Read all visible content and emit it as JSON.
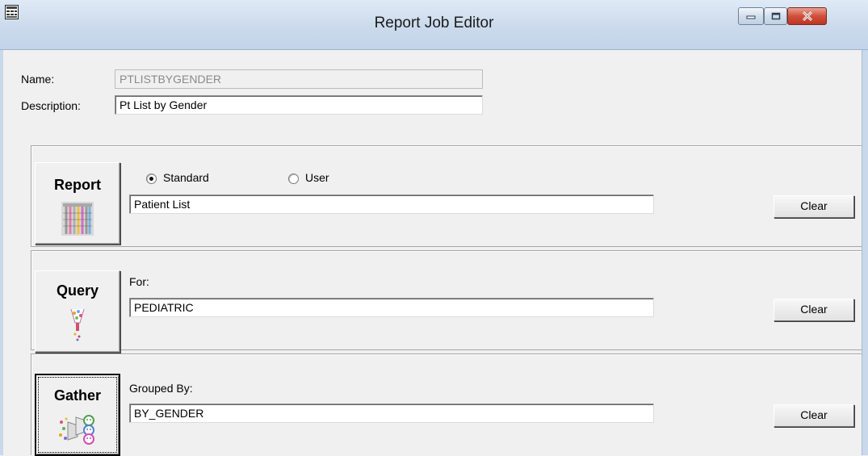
{
  "window": {
    "title": "Report Job Editor"
  },
  "header": {
    "name_label": "Name:",
    "name_value": "PTLISTBYGENDER",
    "description_label": "Description:",
    "description_value": "Pt List by Gender"
  },
  "report": {
    "button_label": "Report",
    "icon": "report-grid-icon",
    "radio_standard": "Standard",
    "radio_user": "User",
    "selected": "Standard",
    "value": "Patient List",
    "clear_label": "Clear"
  },
  "query": {
    "button_label": "Query",
    "icon": "query-funnel-icon",
    "for_label": "For:",
    "value": "PEDIATRIC",
    "clear_label": "Clear"
  },
  "gather": {
    "button_label": "Gather",
    "icon": "gather-people-icon",
    "grouped_label": "Grouped By:",
    "value": "BY_GENDER",
    "clear_label": "Clear"
  },
  "colors": {
    "titlebar": "#cbdaec",
    "close_button": "#d0503b",
    "window_bg": "#f0f0f0"
  }
}
